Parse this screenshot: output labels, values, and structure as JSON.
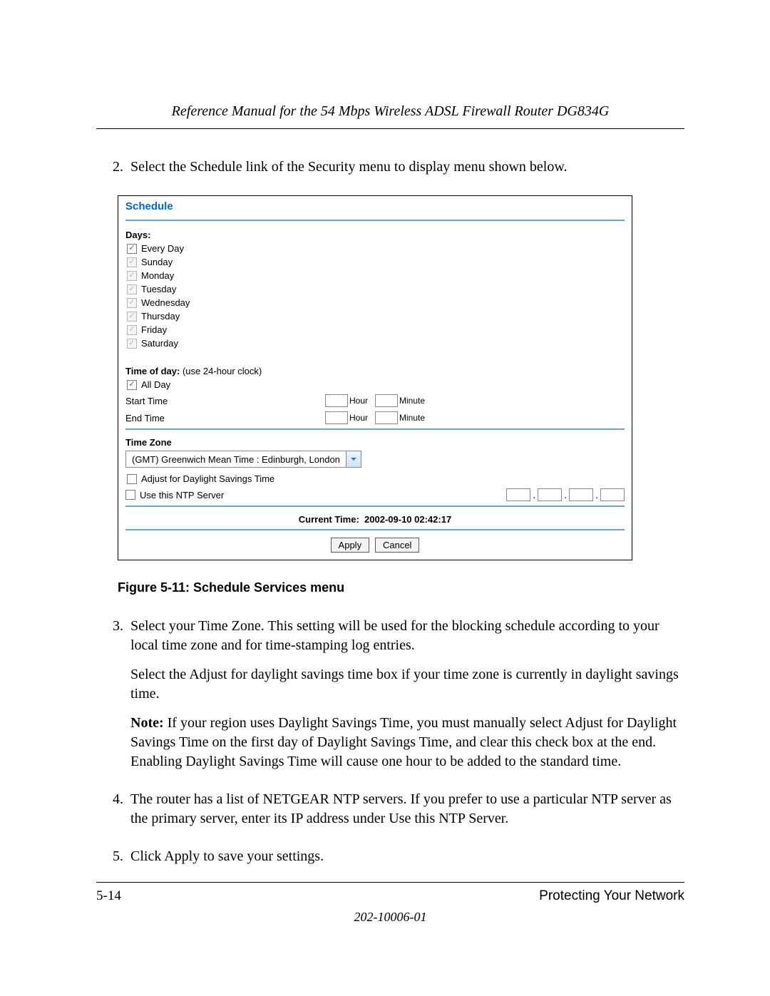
{
  "header": {
    "title": "Reference Manual for the 54 Mbps Wireless ADSL Firewall Router DG834G"
  },
  "steps": {
    "s2": {
      "num": "2.",
      "text": "Select the Schedule link of the Security menu to display menu shown below."
    },
    "s3": {
      "num": "3.",
      "p1": "Select your Time Zone. This setting will be used for the blocking schedule according to your local time zone and for time-stamping log entries.",
      "p2": "Select the Adjust for daylight savings time box if your time zone is currently in daylight savings time.",
      "p3_lead": "Note:",
      "p3_rest": " If your region uses Daylight Savings Time, you must manually select Adjust for Daylight Savings Time on the first day of Daylight Savings Time, and clear this check box at the end. Enabling Daylight Savings Time will cause one hour to be added to the standard time."
    },
    "s4": {
      "num": "4.",
      "text": "The router has a list of NETGEAR NTP servers. If you prefer to use a particular NTP server as the primary server, enter its IP address under Use this NTP Server."
    },
    "s5": {
      "num": "5.",
      "text": "Click Apply to save your settings."
    }
  },
  "screenshot": {
    "title": "Schedule",
    "days_label": "Days:",
    "days": [
      {
        "label": "Every Day",
        "checked": true,
        "disabled": false
      },
      {
        "label": "Sunday",
        "checked": true,
        "disabled": true
      },
      {
        "label": "Monday",
        "checked": true,
        "disabled": true
      },
      {
        "label": "Tuesday",
        "checked": true,
        "disabled": true
      },
      {
        "label": "Wednesday",
        "checked": true,
        "disabled": true
      },
      {
        "label": "Thursday",
        "checked": true,
        "disabled": true
      },
      {
        "label": "Friday",
        "checked": true,
        "disabled": true
      },
      {
        "label": "Saturday",
        "checked": true,
        "disabled": true
      }
    ],
    "tod_label": "Time of day:",
    "tod_note": " (use 24-hour clock)",
    "all_day": {
      "label": "All Day",
      "checked": true
    },
    "start_label": "Start Time",
    "end_label": "End Time",
    "hour_label": "Hour",
    "minute_label": "Minute",
    "tz_label": "Time Zone",
    "tz_value": "(GMT) Greenwich Mean Time : Edinburgh, London",
    "dst_label": "Adjust for Daylight Savings Time",
    "dst_checked": false,
    "ntp_label": "Use this NTP Server",
    "ntp_checked": false,
    "current_time_label": "Current Time:",
    "current_time_value": "2002-09-10 02:42:17",
    "apply_label": "Apply",
    "cancel_label": "Cancel"
  },
  "figure_caption": "Figure 5-11:  Schedule Services menu",
  "footer": {
    "page_num": "5-14",
    "section": "Protecting Your Network",
    "doc_num": "202-10006-01"
  }
}
